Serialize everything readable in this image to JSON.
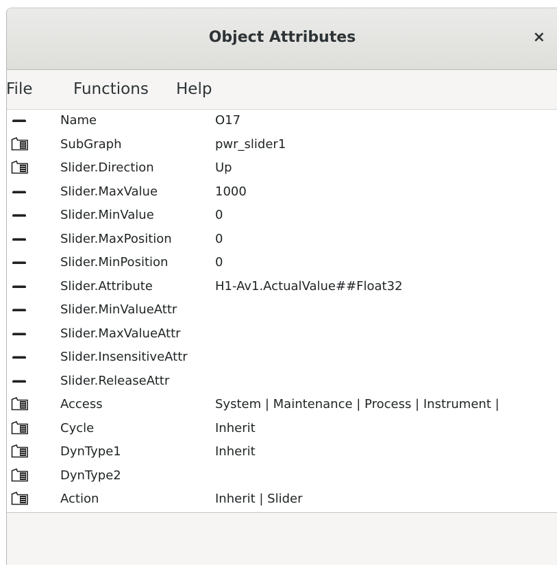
{
  "window": {
    "title": "Object Attributes",
    "close_glyph": "×"
  },
  "menu": [
    "File",
    "Functions",
    "Help"
  ],
  "attributes": [
    {
      "icon": "attr-line-icon",
      "name": "Name",
      "value": "O17"
    },
    {
      "icon": "folder-icon",
      "name": "SubGraph",
      "value": "pwr_slider1"
    },
    {
      "icon": "folder-icon",
      "name": "Slider.Direction",
      "value": "Up"
    },
    {
      "icon": "attr-line-icon",
      "name": "Slider.MaxValue",
      "value": "1000"
    },
    {
      "icon": "attr-line-icon",
      "name": "Slider.MinValue",
      "value": "0"
    },
    {
      "icon": "attr-line-icon",
      "name": "Slider.MaxPosition",
      "value": "0"
    },
    {
      "icon": "attr-line-icon",
      "name": "Slider.MinPosition",
      "value": "0"
    },
    {
      "icon": "attr-line-icon",
      "name": "Slider.Attribute",
      "value": "H1-Av1.ActualValue##Float32"
    },
    {
      "icon": "attr-line-icon",
      "name": "Slider.MinValueAttr",
      "value": ""
    },
    {
      "icon": "attr-line-icon",
      "name": "Slider.MaxValueAttr",
      "value": ""
    },
    {
      "icon": "attr-line-icon",
      "name": "Slider.InsensitiveAttr",
      "value": ""
    },
    {
      "icon": "attr-line-icon",
      "name": "Slider.ReleaseAttr",
      "value": ""
    },
    {
      "icon": "folder-icon",
      "name": "Access",
      "value": "System | Maintenance | Process | Instrument |"
    },
    {
      "icon": "folder-icon",
      "name": "Cycle",
      "value": "Inherit"
    },
    {
      "icon": "folder-icon",
      "name": "DynType1",
      "value": "Inherit"
    },
    {
      "icon": "folder-icon",
      "name": "DynType2",
      "value": ""
    },
    {
      "icon": "folder-icon",
      "name": "Action",
      "value": "Inherit | Slider"
    }
  ]
}
